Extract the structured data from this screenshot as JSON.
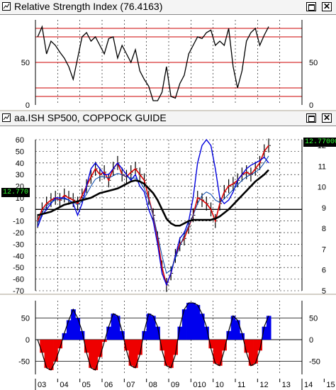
{
  "rsi_panel": {
    "title": "Relative Strength Index (76.4163)",
    "y_left_ticks": [
      "50",
      "0"
    ],
    "y_right_ticks": [
      "50",
      "0"
    ]
  },
  "price_panel": {
    "title": "aa.ISH SP500, COPPOCK GUIDE",
    "left_badge": "12.770",
    "right_badge": "12.77000",
    "left_ticks": [
      "60",
      "50",
      "40",
      "30",
      "20",
      "10",
      "0",
      "-10",
      "-20",
      "-30",
      "-40",
      "-50",
      "-60",
      "-70"
    ],
    "right_ticks": [
      "12",
      "11",
      "10",
      "9",
      "8",
      "7",
      "6",
      "5"
    ]
  },
  "coppock_panel": {
    "y_left_ticks": [
      "50",
      "0",
      "-50"
    ],
    "y_right_ticks": [
      "50",
      "0",
      "-50"
    ]
  },
  "x_axis": {
    "labels": [
      "03",
      "04",
      "05",
      "06",
      "07",
      "08",
      "09",
      "010",
      "10",
      "11",
      "12",
      "13",
      "14",
      "15"
    ]
  },
  "colors": {
    "rsi_line": "#000000",
    "ref_lines": "#cc0000",
    "price_bars": "#000000",
    "ma_red": "#dd0000",
    "ma_blue": "#0000dd",
    "ma_black": "#000000",
    "hist_pos": "#0000ee",
    "hist_neg": "#ee0000",
    "badge_bg": "#000000",
    "badge_fg": "#33ff33"
  },
  "chart_data": [
    {
      "type": "line",
      "title": "Relative Strength Index (76.4163)",
      "x_range": [
        "2003",
        "2015"
      ],
      "ylim": [
        0,
        100
      ],
      "reference_lines": [
        10,
        20,
        50,
        80,
        90
      ],
      "x": [
        2003.1,
        2003.3,
        2003.5,
        2003.7,
        2003.9,
        2004.1,
        2004.3,
        2004.5,
        2004.7,
        2004.9,
        2005.1,
        2005.3,
        2005.5,
        2005.7,
        2005.9,
        2006.1,
        2006.3,
        2006.5,
        2006.7,
        2006.9,
        2007.1,
        2007.3,
        2007.5,
        2007.7,
        2007.9,
        2008.1,
        2008.3,
        2008.5,
        2008.7,
        2008.9,
        2009.1,
        2009.3,
        2009.5,
        2009.7,
        2009.9,
        2010.1,
        2010.3,
        2010.5,
        2010.7,
        2010.9,
        2011.1,
        2011.3,
        2011.5,
        2011.7,
        2011.9,
        2012.1,
        2012.3,
        2012.5,
        2012.7,
        2012.9,
        2013.1,
        2013.3,
        2013.5
      ],
      "series": [
        {
          "values": [
            80,
            92,
            60,
            75,
            70,
            62,
            55,
            45,
            30,
            55,
            80,
            85,
            75,
            80,
            70,
            60,
            78,
            80,
            55,
            70,
            60,
            50,
            65,
            40,
            30,
            22,
            5,
            5,
            15,
            45,
            10,
            8,
            25,
            35,
            60,
            70,
            80,
            78,
            85,
            88,
            70,
            75,
            70,
            90,
            45,
            20,
            40,
            75,
            85,
            90,
            70,
            82,
            92
          ]
        }
      ]
    },
    {
      "type": "line",
      "title": "aa.ISH SP500, COPPOCK GUIDE",
      "x_range": [
        "2003",
        "2015"
      ],
      "ylim": [
        -70,
        60
      ],
      "series": [
        {
          "values": [
            -10,
            0,
            5,
            8,
            10,
            8,
            12,
            10,
            8,
            5,
            12,
            20,
            28,
            35,
            30,
            32,
            25,
            35,
            40,
            30,
            28,
            32,
            35,
            30,
            25,
            10,
            -5,
            -25,
            -50,
            -65,
            -55,
            -40,
            -30,
            -25,
            -15,
            -5,
            10,
            8,
            5,
            0,
            -10,
            5,
            15,
            20,
            22,
            25,
            30,
            32,
            30,
            35,
            40,
            50,
            55
          ]
        },
        {
          "values": [
            -15,
            -5,
            0,
            5,
            10,
            10,
            10,
            8,
            5,
            -5,
            5,
            20,
            35,
            40,
            35,
            30,
            30,
            35,
            40,
            35,
            30,
            25,
            30,
            20,
            15,
            0,
            -10,
            -30,
            -55,
            -65,
            -55,
            -40,
            -25,
            -20,
            -10,
            10,
            40,
            55,
            60,
            55,
            35,
            10,
            5,
            8,
            15,
            25,
            30,
            35,
            38,
            40,
            42,
            45,
            40
          ]
        },
        {
          "values": [
            -12,
            -3,
            3,
            6,
            8,
            9,
            9,
            8,
            6,
            4,
            7,
            13,
            20,
            26,
            28,
            28,
            27,
            29,
            31,
            30,
            28,
            27,
            27,
            24,
            18,
            8,
            -5,
            -22,
            -40,
            -55,
            -52,
            -42,
            -32,
            -22,
            -14,
            -5,
            5,
            12,
            15,
            13,
            8,
            6,
            9,
            13,
            17,
            21,
            25,
            28,
            30,
            32,
            35,
            40,
            46
          ]
        },
        {
          "values": [
            -5,
            -4,
            -3,
            -2,
            0,
            2,
            4,
            5,
            6,
            7,
            8,
            9,
            10,
            12,
            14,
            15,
            16,
            17,
            18,
            20,
            22,
            24,
            25,
            24,
            22,
            18,
            14,
            8,
            0,
            -8,
            -12,
            -14,
            -14,
            -12,
            -10,
            -9,
            -9,
            -9,
            -9,
            -9,
            -8,
            -6,
            -3,
            0,
            4,
            8,
            12,
            16,
            20,
            24,
            27,
            30,
            34
          ]
        }
      ]
    },
    {
      "type": "bar",
      "title": "",
      "x_range": [
        "2003",
        "2015"
      ],
      "ylim": [
        -80,
        90
      ],
      "x": [
        2003.1,
        2003.3,
        2003.5,
        2003.7,
        2003.9,
        2004.1,
        2004.3,
        2004.5,
        2004.7,
        2004.9,
        2005.1,
        2005.3,
        2005.5,
        2005.7,
        2005.9,
        2006.1,
        2006.3,
        2006.5,
        2006.7,
        2006.9,
        2007.1,
        2007.3,
        2007.5,
        2007.7,
        2007.9,
        2008.1,
        2008.3,
        2008.5,
        2008.7,
        2008.9,
        2009.1,
        2009.3,
        2009.5,
        2009.7,
        2009.9,
        2010.1,
        2010.3,
        2010.5,
        2010.7,
        2010.9,
        2011.1,
        2011.3,
        2011.5,
        2011.7,
        2011.9,
        2012.1,
        2012.3,
        2012.5,
        2012.7,
        2012.9,
        2013.1,
        2013.3,
        2013.5
      ],
      "series": [
        {
          "values": [
            0,
            -30,
            -65,
            -70,
            -50,
            -20,
            15,
            45,
            70,
            50,
            20,
            -30,
            -65,
            -70,
            -40,
            -5,
            30,
            60,
            55,
            20,
            -25,
            -60,
            -65,
            -35,
            20,
            60,
            55,
            30,
            -25,
            -60,
            -65,
            -35,
            30,
            70,
            85,
            85,
            80,
            60,
            30,
            -20,
            -55,
            -60,
            -25,
            20,
            55,
            45,
            15,
            -30,
            -60,
            -55,
            -25,
            30,
            55
          ]
        }
      ]
    }
  ]
}
